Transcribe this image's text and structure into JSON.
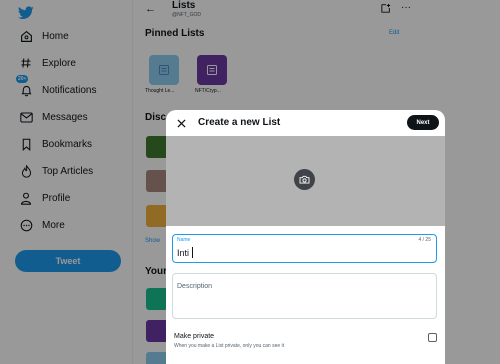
{
  "colors": {
    "accent": "#1d9bf0",
    "pin_1": "#8ecdf0",
    "pin_2": "#6b3aa6",
    "overlay": "rgba(0,0,0,0.4)",
    "banner": "#b3b3b3",
    "next_button": "#0f1419"
  },
  "sidebar": {
    "logo_icon": "bird-icon",
    "items": [
      {
        "label": "Home",
        "icon": "home-icon"
      },
      {
        "label": "Explore",
        "icon": "hashtag-icon"
      },
      {
        "label": "Notifications",
        "icon": "bell-icon",
        "badge": "20+"
      },
      {
        "label": "Messages",
        "icon": "envelope-icon"
      },
      {
        "label": "Bookmarks",
        "icon": "bookmark-icon"
      },
      {
        "label": "Top Articles",
        "icon": "flame-icon"
      },
      {
        "label": "Profile",
        "icon": "person-icon"
      },
      {
        "label": "More",
        "icon": "more-circle-icon"
      }
    ],
    "tweet_label": "Tweet"
  },
  "main": {
    "title": "Lists",
    "handle": "@NFT_GOD",
    "pinned_title": "Pinned Lists",
    "pinned_edit": "Edit",
    "pinned": [
      {
        "label": "Thought Le..."
      },
      {
        "label": "NFT/Cryp..."
      }
    ],
    "discover_title": "Disc",
    "show_more": "Show",
    "your_lists_title": "Your"
  },
  "modal": {
    "title": "Create a new List",
    "next_label": "Next",
    "name_label": "Name",
    "name_value": "Inti",
    "name_counter": "4 / 25",
    "description_placeholder": "Description",
    "private_title": "Make private",
    "private_subtitle": "When you make a List private, only you can see it"
  }
}
